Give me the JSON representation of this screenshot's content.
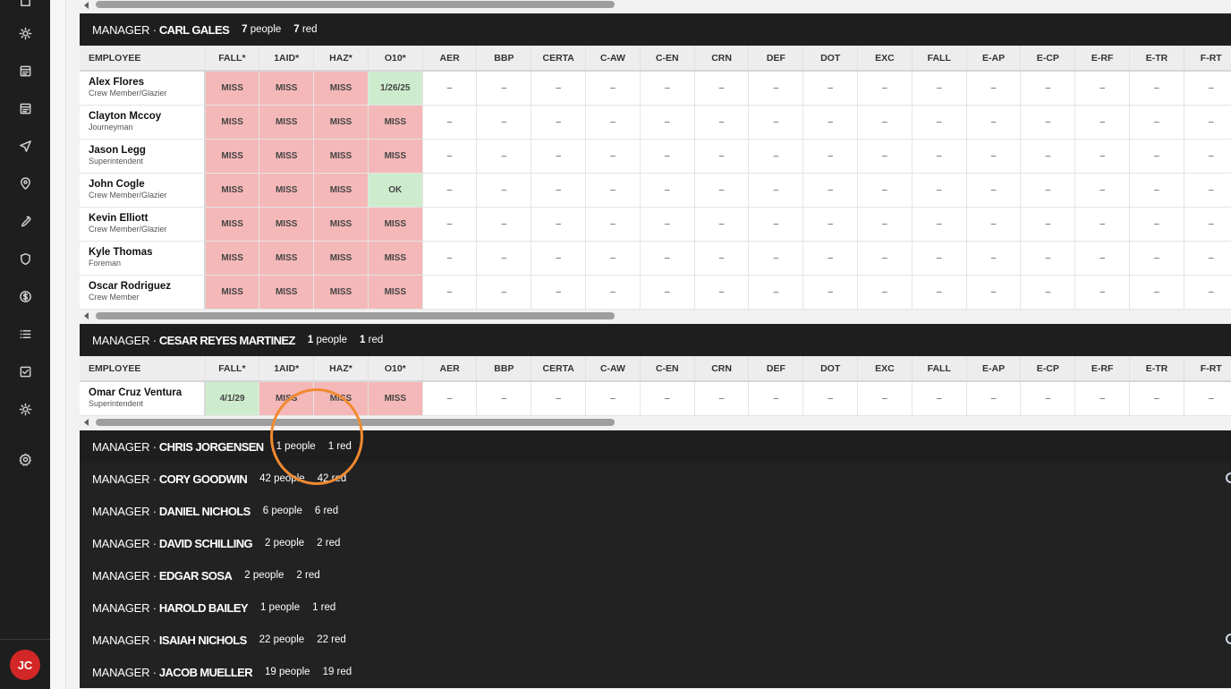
{
  "sidebar": {
    "icons": [
      "grid-icon",
      "sun-icon",
      "doc-icon",
      "doc-icon-2",
      "send-icon",
      "pin-icon",
      "wrench-icon",
      "shield-icon",
      "dollar-icon",
      "list-icon",
      "check-square-icon",
      "sun-icon-2",
      "gear-icon"
    ],
    "avatar_initials": "JC"
  },
  "columns": [
    "EMPLOYEE",
    "FALL*",
    "1AID*",
    "HAZ*",
    "O10*",
    "AER",
    "BBP",
    "CERTA",
    "C-AW",
    "C-EN",
    "CRN",
    "DEF",
    "DOT",
    "EXC",
    "FALL",
    "E-AP",
    "E-CP",
    "E-RF",
    "E-TR",
    "F-RT"
  ],
  "dash": "–",
  "groups": [
    {
      "prefix": "MANAGER ·",
      "name": "CARL GALES",
      "people": "7",
      "people_label": "people",
      "red": "7",
      "red_label": "red",
      "rows": [
        {
          "name": "Alex Flores",
          "role": "Crew Member/Glazier",
          "cells": [
            "MISS",
            "MISS",
            "MISS",
            "1/26/25"
          ]
        },
        {
          "name": "Clayton Mccoy",
          "role": "Journeyman",
          "cells": [
            "MISS",
            "MISS",
            "MISS",
            "MISS"
          ]
        },
        {
          "name": "Jason Legg",
          "role": "Superintendent",
          "cells": [
            "MISS",
            "MISS",
            "MISS",
            "MISS"
          ]
        },
        {
          "name": "John Cogle",
          "role": "Crew Member/Glazier",
          "cells": [
            "MISS",
            "MISS",
            "MISS",
            "OK"
          ]
        },
        {
          "name": "Kevin Elliott",
          "role": "Crew Member/Glazier",
          "cells": [
            "MISS",
            "MISS",
            "MISS",
            "MISS"
          ]
        },
        {
          "name": "Kyle Thomas",
          "role": "Foreman",
          "cells": [
            "MISS",
            "MISS",
            "MISS",
            "MISS"
          ]
        },
        {
          "name": "Oscar Rodriguez",
          "role": "Crew Member",
          "cells": [
            "MISS",
            "MISS",
            "MISS",
            "MISS"
          ]
        }
      ]
    },
    {
      "prefix": "MANAGER ·",
      "name": "CESAR REYES MARTINEZ",
      "people": "1",
      "people_label": "people",
      "red": "1",
      "red_label": "red",
      "rows": [
        {
          "name": "Omar Cruz Ventura",
          "role": "Superintendent",
          "cells": [
            "4/1/29",
            "MISS",
            "MISS",
            "MISS"
          ]
        }
      ]
    }
  ],
  "collapsed_groups": [
    {
      "prefix": "MANAGER ·",
      "name": "CHRIS JORGENSEN",
      "people": "1 people",
      "red": "1 red"
    },
    {
      "prefix": "MANAGER ·",
      "name": "CORY GOODWIN",
      "people": "42 people",
      "red": "42 red"
    },
    {
      "prefix": "MANAGER ·",
      "name": "DANIEL NICHOLS",
      "people": "6 people",
      "red": "6 red"
    },
    {
      "prefix": "MANAGER ·",
      "name": "DAVID SCHILLING",
      "people": "2 people",
      "red": "2 red"
    },
    {
      "prefix": "MANAGER ·",
      "name": "EDGAR SOSA",
      "people": "2 people",
      "red": "2 red"
    },
    {
      "prefix": "MANAGER ·",
      "name": "HAROLD BAILEY",
      "people": "1 people",
      "red": "1 red"
    },
    {
      "prefix": "MANAGER ·",
      "name": "ISAIAH NICHOLS",
      "people": "22 people",
      "red": "22 red"
    },
    {
      "prefix": "MANAGER ·",
      "name": "JACOB MUELLER",
      "people": "19 people",
      "red": "19 red"
    }
  ],
  "colors": {
    "miss_bg": "#f5b8b8",
    "ok_bg": "#cdeccd",
    "highlight_ring": "#f08a30",
    "bar_bg": "#1e1e1e"
  }
}
